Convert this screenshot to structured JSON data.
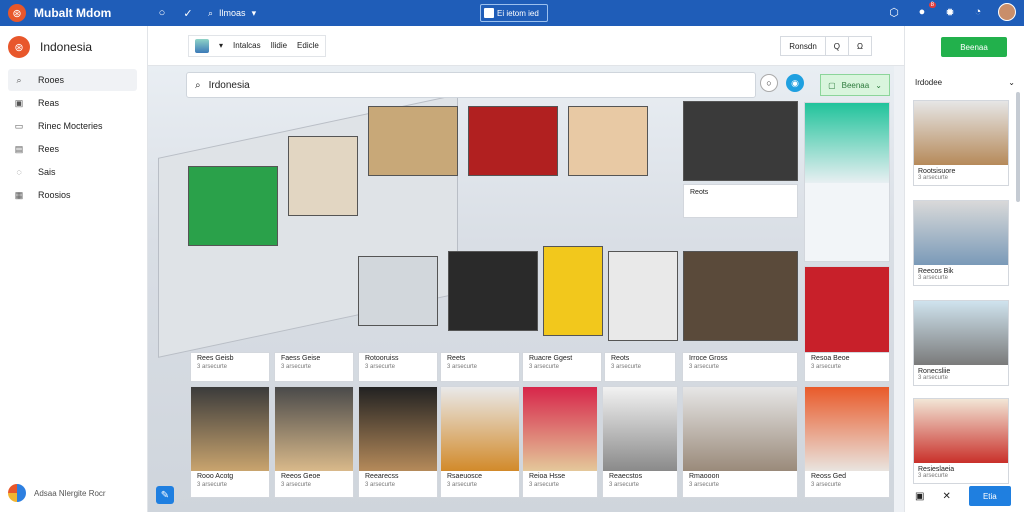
{
  "app": {
    "title": "Mubalt Mdom",
    "center_chip": "Ei ietom ied"
  },
  "top": {
    "search_label": "Ilmoas",
    "badge": "8"
  },
  "sidebar": {
    "title": "Indonesia",
    "items": [
      {
        "label": "Rooes",
        "icon": "search-icon"
      },
      {
        "label": "Reas",
        "icon": "user-icon"
      },
      {
        "label": "Rinec Mocteries",
        "icon": "folder-icon"
      },
      {
        "label": "Rees",
        "icon": "calendar-icon"
      },
      {
        "label": "Sais",
        "icon": "chat-icon"
      },
      {
        "label": "Roosios",
        "icon": "settings-icon"
      }
    ],
    "footer": "Adsaa Nlergite Rocr"
  },
  "toolbar": {
    "items": [
      "Intalcas",
      "Ilidie",
      "Edicle"
    ],
    "right": [
      "Ronsdn",
      "Q",
      "Ω"
    ]
  },
  "search": {
    "value": "Irdonesia"
  },
  "filter": {
    "label": "Beenaa"
  },
  "grid": [
    {
      "title": "Rees Geisb",
      "sub": "3 arsecurte"
    },
    {
      "title": "Faess Geise",
      "sub": "3 arsecurte"
    },
    {
      "title": "Rotooruiss",
      "sub": "3 arsecurte"
    },
    {
      "title": "Reets",
      "sub": "3 arsecurte"
    },
    {
      "title": "Ruacre Ggest",
      "sub": "3 arsecurte"
    },
    {
      "title": "Reots",
      "sub": "3 arsecurte"
    },
    {
      "title": "Irroce Gross",
      "sub": "3 arsecurte"
    },
    {
      "title": "Resoa Beoe",
      "sub": "3 arsecurte"
    },
    {
      "title": "Rooo Acotg",
      "sub": "3 arsecurte"
    },
    {
      "title": "Reeos Geoe",
      "sub": "3 arsecurte"
    },
    {
      "title": "Reearecss",
      "sub": "3 arsecurte"
    },
    {
      "title": "Rsaeuosce",
      "sub": "3 arsecurte"
    },
    {
      "title": "Reioa Hsse",
      "sub": "3 arsecurte"
    },
    {
      "title": "Reaecstos",
      "sub": "3 arsecurte"
    },
    {
      "title": "Rmaooon",
      "sub": "3 arsecurte"
    },
    {
      "title": "Reoss Ged",
      "sub": "3 arsecurte"
    }
  ],
  "rightpanel": {
    "button": "Beenaa",
    "header": "Irdodee",
    "cards": [
      {
        "title": "Rootsisuore",
        "sub": "3 arsecurte"
      },
      {
        "title": "Reecos Bik",
        "sub": "3 arsecurte"
      },
      {
        "title": "Ronecsliie",
        "sub": "3 arsecurte"
      },
      {
        "title": "Resieslaeia",
        "sub": "3 arsecurte"
      }
    ],
    "primary": "Etia"
  }
}
